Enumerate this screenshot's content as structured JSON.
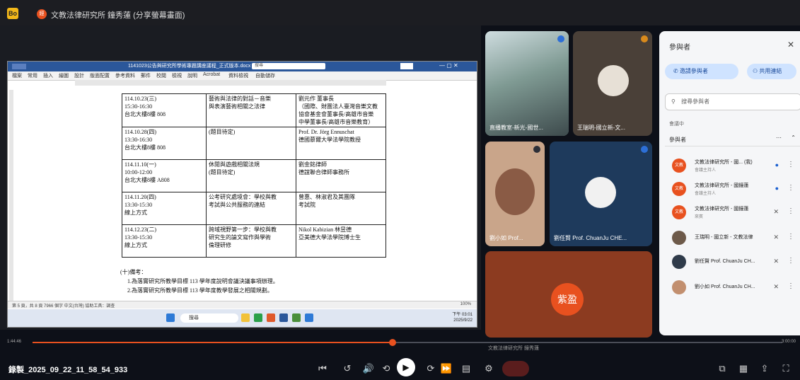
{
  "app": {
    "logo_text": "Bo",
    "meeting_badge": "經",
    "meeting_title": "文教法律研究所 鐘秀蓮 (分享螢幕畫面)"
  },
  "word": {
    "filename": "1141023公告與研究所學術專題講座議程_正式版本.docx - 唯讀 - Word",
    "search_placeholder": "搜尋",
    "menu": [
      "檔案",
      "常用",
      "插入",
      "繪圖",
      "設計",
      "版面配置",
      "參考資料",
      "郵件",
      "校閱",
      "檢視",
      "說明",
      "Acrobat",
      "資料檢視",
      "自動儲存"
    ],
    "table": [
      {
        "time": [
          "114.10.23(三)",
          "15:30-16:30",
          "台北大樓8樓 808"
        ],
        "topic": [
          "藝術與法律的對話－音樂",
          "與表演藝術相關之法律"
        ],
        "speaker": [
          "劉元作 董事長",
          "（國際、財團法人臺灣音樂文教",
          "協會基金會董事長/高雄市音樂",
          "中學董事長/高雄市音樂教育）"
        ]
      },
      {
        "time": [
          "114.10.28(四)",
          "13:30-16:30",
          "台北大樓8樓 808"
        ],
        "topic": [
          "(題目待定)"
        ],
        "speaker": [
          "Prof. Dr. Jörg Ennuschat",
          "德國慕爾大學法學院教授"
        ]
      },
      {
        "time": [
          "114.11.10(一)",
          "10:00-12:00",
          "台北大樓8樓 A808"
        ],
        "topic": [
          "休閒與遊戲相關法規",
          "(題目待定)"
        ],
        "speaker": [
          "劉金銘律師",
          "德誼聯合律師事務所"
        ]
      },
      {
        "time": [
          "114.11.20(四)",
          "13:30-15:30",
          "線上方式"
        ],
        "topic": [
          "公考研究處境會：學校與教",
          "考試與公共服務的連結"
        ],
        "speaker": [
          "曾惠、林淑君及其團隊",
          "考試院"
        ]
      },
      {
        "time": [
          "114.12.23(二)",
          "13:30-15:30",
          "線上方式"
        ],
        "topic": [
          "跨域視野第一步：學校與教",
          "研究生的論文寫作與學術",
          "倫理研修"
        ],
        "speaker": [
          "Nikol Kabizian 林昱德",
          "亞美德大學法學院博士生"
        ]
      }
    ],
    "notes": [
      "(十)備考：",
      "1.為落實研究所教學目標 113 學年度說明會議決議事項辦理。",
      "2.為落實研究所教學目標 113 學年度教學發展之相關規劃。"
    ],
    "status": "第 5 頁，共 8 頁   7966 個字   中文(台灣)   協助工具：調查",
    "zoom": "100%"
  },
  "taskbar": {
    "search": "搜尋",
    "time": "下午 03:01",
    "date": "2025/9/22"
  },
  "tiles": [
    {
      "name": "直播教室-新光-國世..."
    },
    {
      "name": "王瑞明-國立新-文..."
    },
    {
      "name": "劉小如 Prof..."
    },
    {
      "name": "劉任賢 Prof. ChuanJu CHE..."
    },
    {
      "name": "紫盈"
    }
  ],
  "panel": {
    "title": "參與者",
    "close": "✕",
    "invite_btn": "邀請參與者",
    "share_btn": "共用連結",
    "search_placeholder": "搜尋參與者",
    "section": "會議中",
    "group": "參與者",
    "participants": [
      {
        "avatar": "文教",
        "name": "文教法律研究所 - 國... (我)",
        "sub": "會議主持人",
        "color": "#e8511f"
      },
      {
        "avatar": "文教",
        "name": "文教法律研究所 - 國鐘蓮",
        "sub": "會議主持人",
        "color": "#e8511f"
      },
      {
        "avatar": "文教",
        "name": "文教法律研究所 - 國鐘蓮",
        "sub": "來賓",
        "color": "#e8511f"
      },
      {
        "avatar": "",
        "name": "王瑞明 - 國立新 - 文教法律",
        "sub": "",
        "color": "#6d5a4a"
      },
      {
        "avatar": "",
        "name": "劉任賢 Prof. ChuanJu CH...",
        "sub": "",
        "color": "#2f3b4a"
      },
      {
        "avatar": "",
        "name": "劉小如 Prof. ChuanJu CH...",
        "sub": "",
        "color": "#c28f6f"
      }
    ]
  },
  "player": {
    "time_current": "1:44:46",
    "time_total": "3:00:00",
    "progress": 0.48,
    "hover_title": "文教法律研究所 鐘秀蓮",
    "recording_name": "錄製_2025_09_22_11_58_54_933"
  }
}
